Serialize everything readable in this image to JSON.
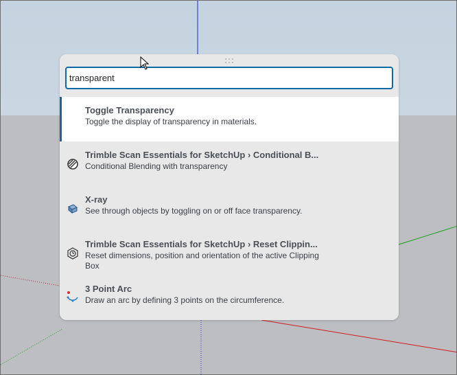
{
  "search": {
    "value": "transparent"
  },
  "results": [
    {
      "title": "Toggle Transparency",
      "description": "Toggle the display of transparency in materials.",
      "icon": "none"
    },
    {
      "title": "Trimble Scan Essentials for SketchUp › Conditional B...",
      "description": "Conditional Blending with transparency",
      "icon": "conditional-blending-icon"
    },
    {
      "title": "X-ray",
      "description": "See through objects by toggling on or off face transparency.",
      "icon": "xray-cube-icon"
    },
    {
      "title": "Trimble Scan Essentials for SketchUp › Reset Clippin...",
      "description": "Reset dimensions, position and orientation of the active Clipping Box",
      "icon": "reset-clipping-box-icon"
    },
    {
      "title": "3 Point Arc",
      "description": "Draw an arc by defining 3 points on the circumference.",
      "icon": "three-point-arc-icon"
    }
  ],
  "colors": {
    "accent": "#0e6aa6",
    "selected_bar": "#24628f",
    "palette_bg": "#e8e8e8"
  }
}
